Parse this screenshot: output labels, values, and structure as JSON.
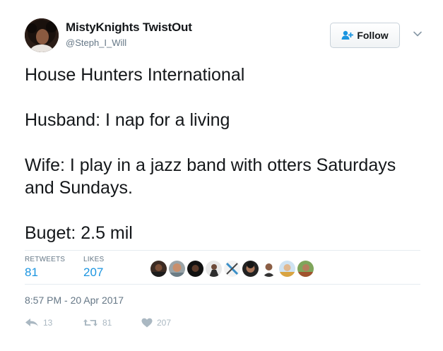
{
  "author": {
    "display_name": "MistyKnights TwistOut",
    "handle": "@Steph_I_Will"
  },
  "follow_button": {
    "label": "Follow",
    "icon": "follow-user-plus-icon"
  },
  "more_menu": {
    "icon": "chevron-down-icon"
  },
  "tweet": {
    "text": "House Hunters International\n\nHusband: I nap for a living\n\nWife: I play in a jazz band with otters Saturdays and Sundays.\n\nBuget: 2.5 mil"
  },
  "stats": {
    "retweets_label": "RETWEETS",
    "retweets_value": "81",
    "likes_label": "LIKES",
    "likes_value": "207"
  },
  "timestamp": "8:57 PM - 20 Apr 2017",
  "actions": {
    "reply_count": "13",
    "retweet_count": "81",
    "like_count": "207"
  },
  "colors": {
    "link_blue": "#1b95e0",
    "muted_gray": "#657786",
    "action_gray": "#aab8c2",
    "text": "#14171a"
  }
}
